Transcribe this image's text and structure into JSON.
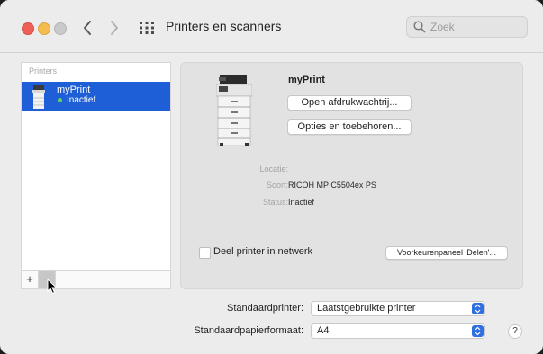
{
  "window": {
    "title": "Printers en scanners"
  },
  "search": {
    "placeholder": "Zoek"
  },
  "printers_list": {
    "header": "Printers",
    "items": [
      {
        "name": "myPrint",
        "status": "Inactief"
      }
    ],
    "add_label": "+",
    "remove_label": "−"
  },
  "detail": {
    "printer_name": "myPrint",
    "open_queue_label": "Open afdrukwachtrij...",
    "options_label": "Opties en toebehoren...",
    "location_label": "Locatie:",
    "location_value": "",
    "kind_label": "Soort:",
    "kind_value": "RICOH MP C5504ex PS",
    "status_label": "Status:",
    "status_value": "Inactief",
    "share_label": "Deel printer in netwerk",
    "share_checked": false,
    "sharing_pref_label": "Voorkeurenpaneel 'Delen'..."
  },
  "defaults": {
    "printer_label": "Standaardprinter:",
    "printer_value": "Laatstgebruikte printer",
    "paper_label": "Standaardpapierformaat:",
    "paper_value": "A4"
  },
  "help_label": "?",
  "colors": {
    "selection": "#1e5ed6",
    "status_dot": "#5fd35a",
    "close": "#ee5f57",
    "minimize": "#f5bd4f",
    "accent": "#2f6fe0"
  },
  "icons": [
    "back-chevron-icon",
    "forward-chevron-icon",
    "grid-icon",
    "search-icon",
    "printer-icon",
    "cursor-icon"
  ]
}
